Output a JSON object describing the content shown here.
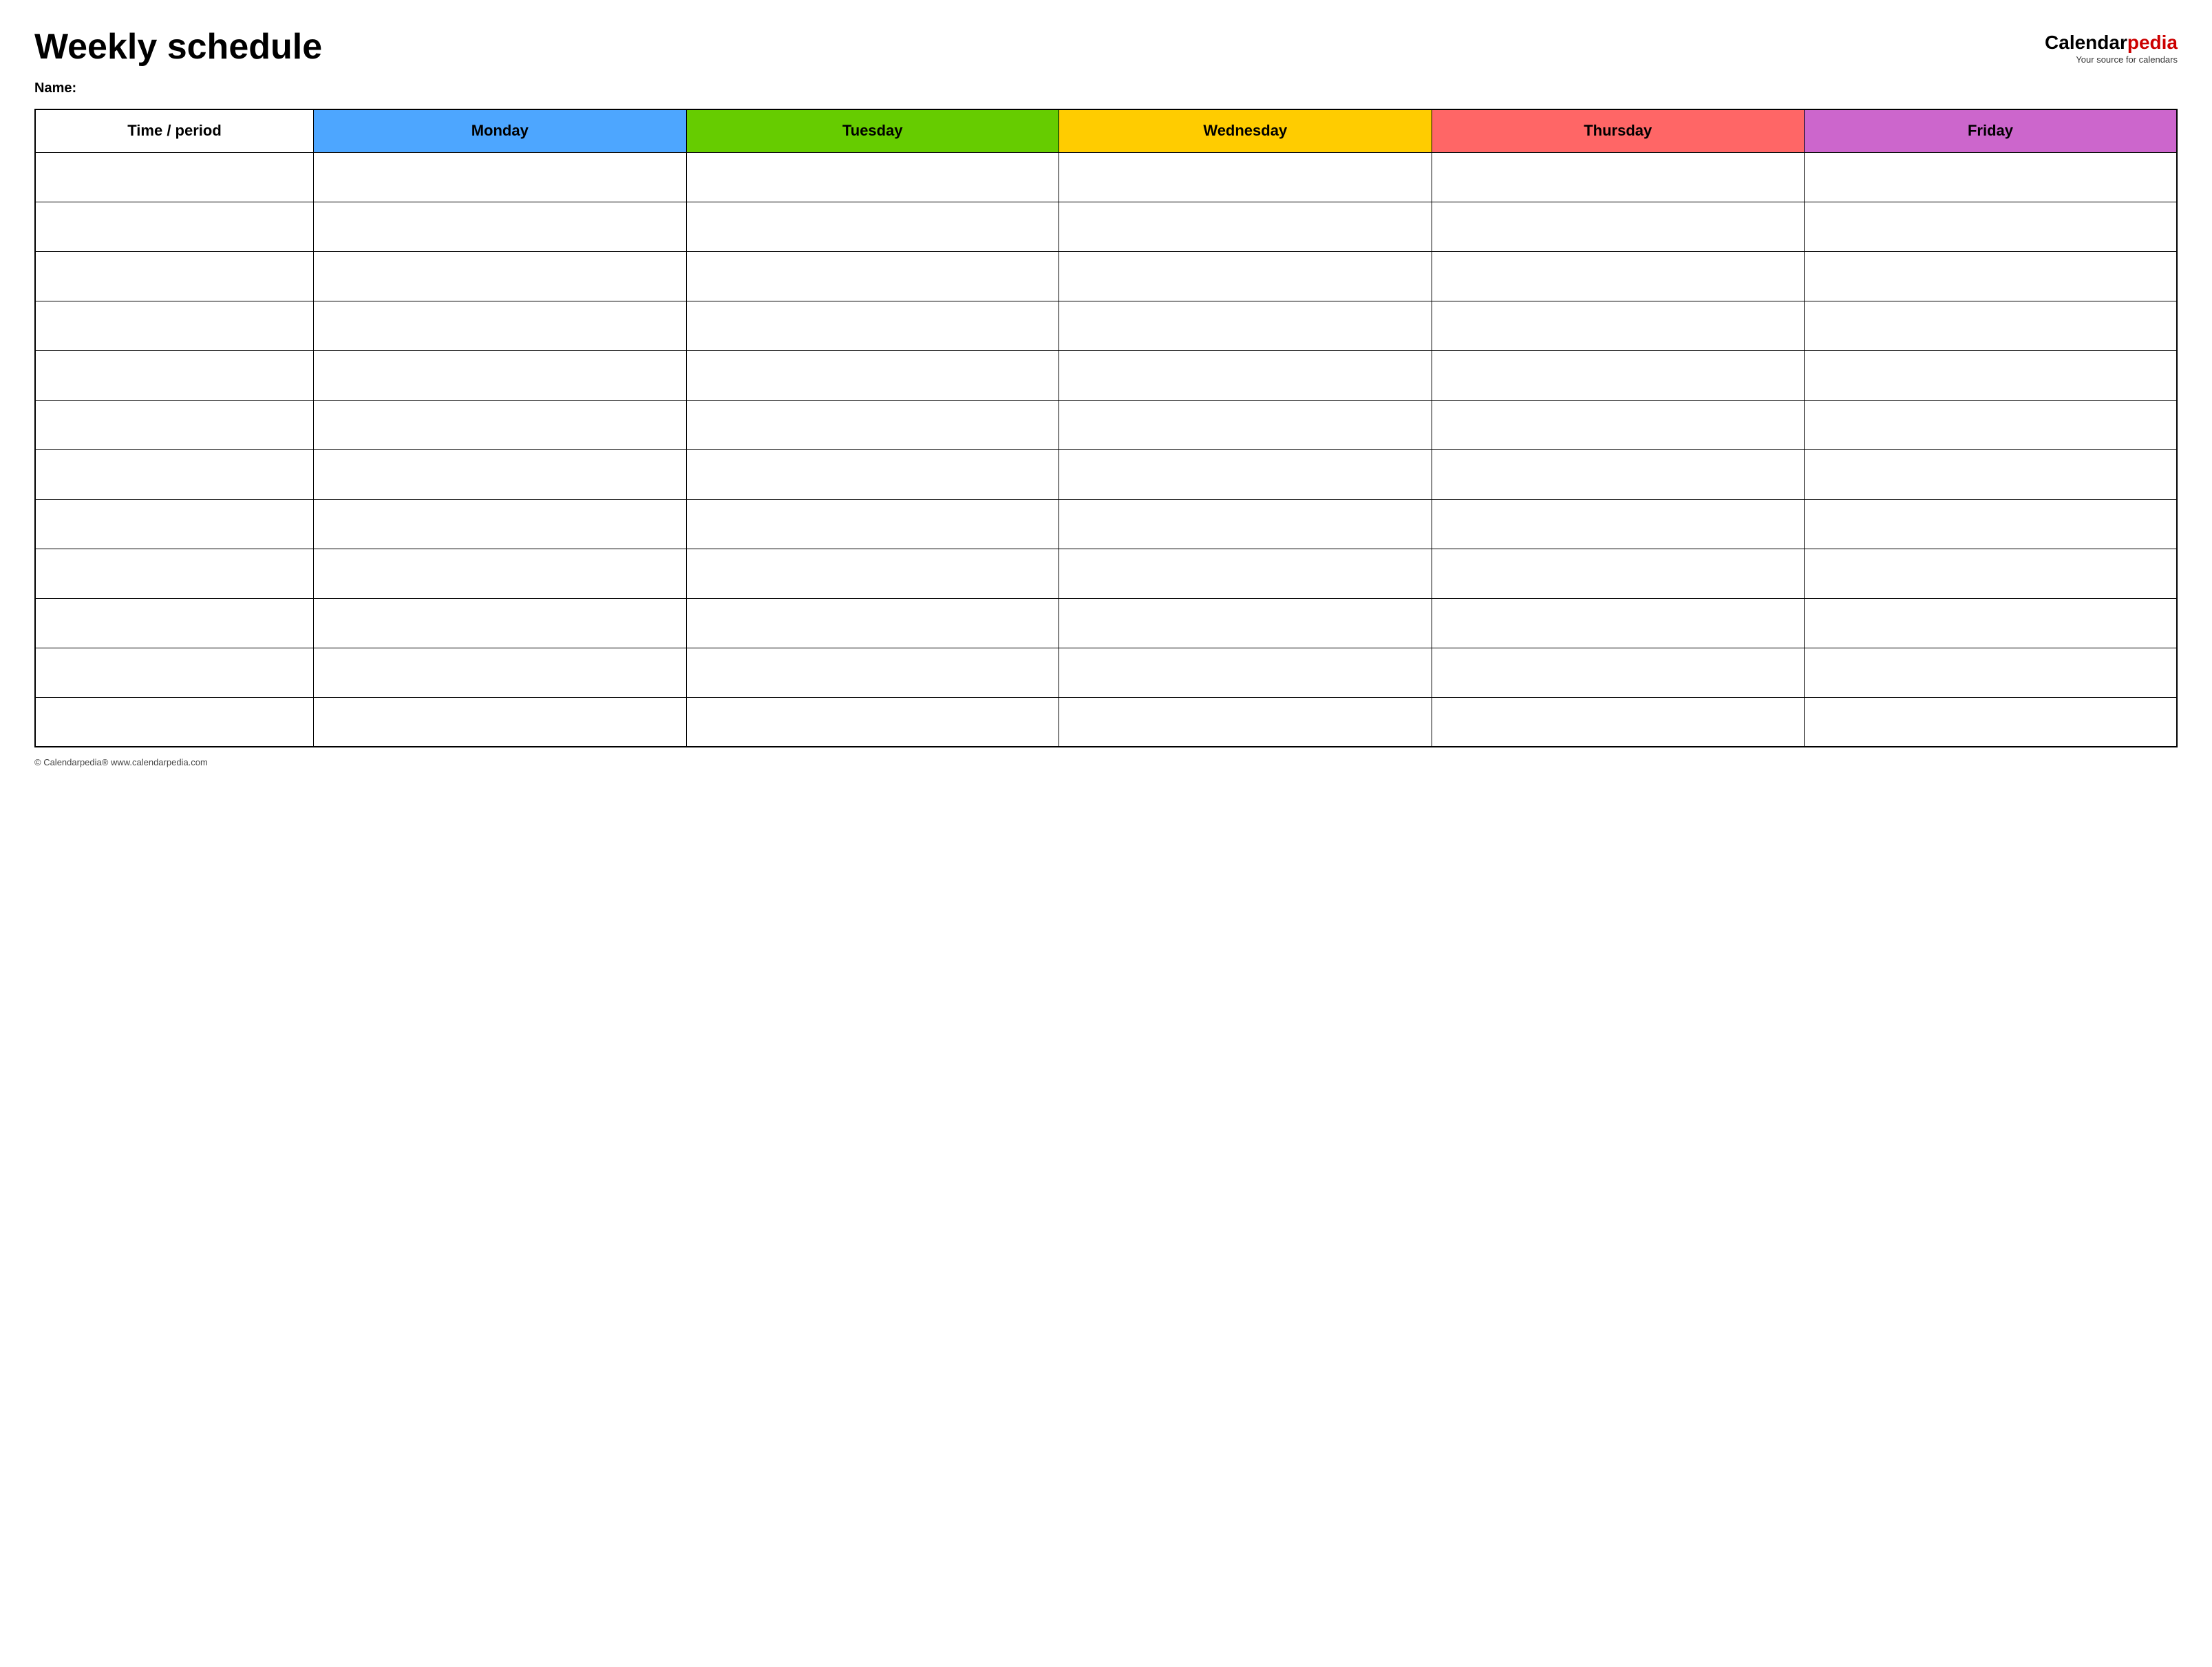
{
  "header": {
    "title": "Weekly schedule",
    "logo": {
      "calendar_part": "Calendar",
      "pedia_part": "pedia",
      "tagline": "Your source for calendars"
    },
    "name_label": "Name:"
  },
  "table": {
    "columns": [
      {
        "id": "time",
        "label": "Time / period",
        "color": "#ffffff"
      },
      {
        "id": "monday",
        "label": "Monday",
        "color": "#4da6ff"
      },
      {
        "id": "tuesday",
        "label": "Tuesday",
        "color": "#66cc00"
      },
      {
        "id": "wednesday",
        "label": "Wednesday",
        "color": "#ffcc00"
      },
      {
        "id": "thursday",
        "label": "Thursday",
        "color": "#ff6666"
      },
      {
        "id": "friday",
        "label": "Friday",
        "color": "#cc66cc"
      }
    ],
    "row_count": 12
  },
  "footer": {
    "copyright": "© Calendarpedia®  www.calendarpedia.com"
  }
}
